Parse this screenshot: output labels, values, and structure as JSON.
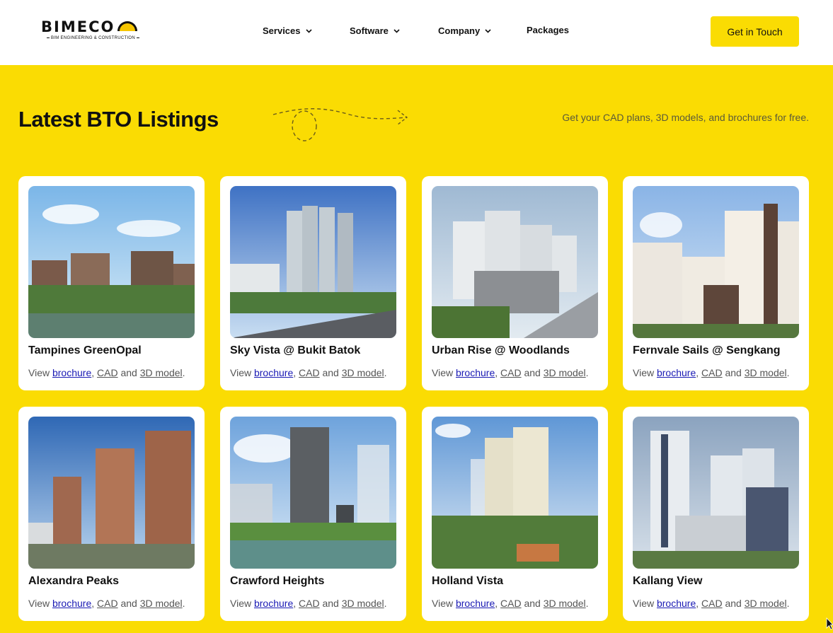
{
  "header": {
    "logo": {
      "name": "BIMECO",
      "tagline": "BIM ENGINEERING & CONSTRUCTION"
    },
    "nav": [
      {
        "label": "Services",
        "has_dropdown": true,
        "icon": "chevron-down-icon"
      },
      {
        "label": "Software",
        "has_dropdown": true,
        "icon": "chevron-down-icon"
      },
      {
        "label": "Company",
        "has_dropdown": true,
        "icon": "chevron-down-icon"
      },
      {
        "label": "Packages",
        "has_dropdown": false
      }
    ],
    "cta_label": "Get in Touch"
  },
  "section": {
    "title": "Latest BTO Listings",
    "subtitle": "Get your CAD plans, 3D models, and brochures for free."
  },
  "cards": [
    {
      "title": "Tampines GreenOpal",
      "view": "View",
      "brochure": "brochure",
      "comma": ",",
      "cad": "CAD",
      "and": "and",
      "model": "3D model",
      "end": "."
    },
    {
      "title": "Sky Vista @ Bukit Batok",
      "view": "View",
      "brochure": "brochure",
      "comma": ",",
      "cad": "CAD",
      "and": "and",
      "model": "3D model",
      "end": "."
    },
    {
      "title": "Urban Rise @ Woodlands",
      "view": "View",
      "brochure": "brochure",
      "comma": ",",
      "cad": "CAD",
      "and": "and",
      "model": "3D model",
      "end": "."
    },
    {
      "title": "Fernvale Sails @ Sengkang",
      "view": "View",
      "brochure": "brochure",
      "comma": ",",
      "cad": "CAD",
      "and": "and",
      "model": "3D model",
      "end": "."
    },
    {
      "title": "Alexandra Peaks",
      "view": "View",
      "brochure": "brochure",
      "comma": ",",
      "cad": "CAD",
      "and": "and",
      "model": "3D model",
      "end": "."
    },
    {
      "title": "Crawford Heights",
      "view": "View",
      "brochure": "brochure",
      "comma": ",",
      "cad": "CAD",
      "and": "and",
      "model": "3D model",
      "end": "."
    },
    {
      "title": "Holland Vista",
      "view": "View",
      "brochure": "brochure",
      "comma": ",",
      "cad": "CAD",
      "and": "and",
      "model": "3D model",
      "end": "."
    },
    {
      "title": "Kallang View",
      "view": "View",
      "brochure": "brochure",
      "comma": ",",
      "cad": "CAD",
      "and": "and",
      "model": "3D model",
      "end": "."
    }
  ],
  "colors": {
    "accent": "#fadc03",
    "header_bg": "#ffffff",
    "card_bg": "#ffffff",
    "link_visited": "#1a1ab4"
  }
}
